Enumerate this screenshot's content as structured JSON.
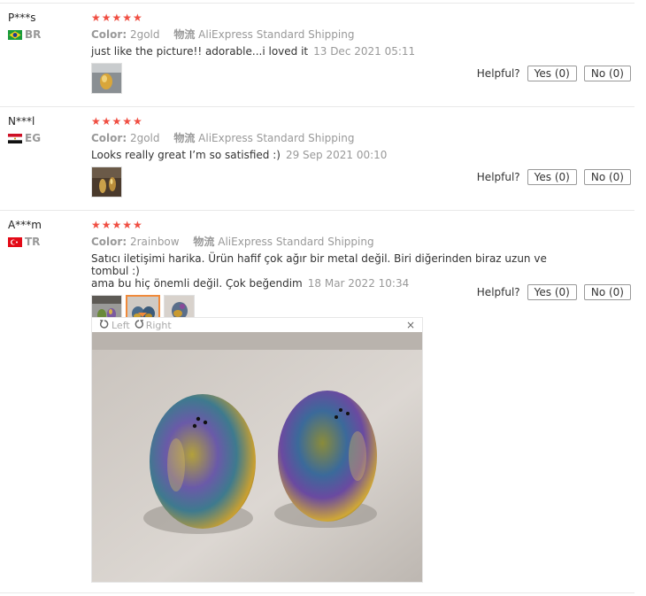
{
  "reviews": [
    {
      "user": "P***s",
      "country": "BR",
      "stars": "★★★★★",
      "color_label": "Color:",
      "color_value": "2gold",
      "shipping_label": "物流",
      "shipping_value": "AliExpress Standard Shipping",
      "text": "just like the picture!! adorable...i loved it",
      "date": "13 Dec 2021 05:11",
      "helpful_label": "Helpful?",
      "yes_label": "Yes (0)",
      "no_label": "No (0)"
    },
    {
      "user": "N***l",
      "country": "EG",
      "stars": "★★★★★",
      "color_label": "Color:",
      "color_value": "2gold",
      "shipping_label": "物流",
      "shipping_value": "AliExpress Standard Shipping",
      "text": "Looks really great I’m so satisfied :)",
      "date": "29 Sep 2021 00:10",
      "helpful_label": "Helpful?",
      "yes_label": "Yes (0)",
      "no_label": "No (0)"
    },
    {
      "user": "A***m",
      "country": "TR",
      "stars": "★★★★★",
      "color_label": "Color:",
      "color_value": "2rainbow",
      "shipping_label": "物流",
      "shipping_value": "AliExpress Standard Shipping",
      "text_line1": "Satıcı iletişimi harika. Ürün hafif çok ağır bir metal değil. Biri diğerinden biraz uzun ve tombul :)",
      "text_line2": "ama bu hiç önemli değil. Çok beğendim",
      "date": "18 Mar 2022 10:34",
      "helpful_label": "Helpful?",
      "yes_label": "Yes (0)",
      "no_label": "No (0)"
    }
  ],
  "viewer": {
    "rotate_left_label": "Left",
    "rotate_right_label": "Right",
    "close_symbol": "×"
  },
  "colors": {
    "star": "#f04e42",
    "active_thumb_border": "#f08a3a"
  }
}
